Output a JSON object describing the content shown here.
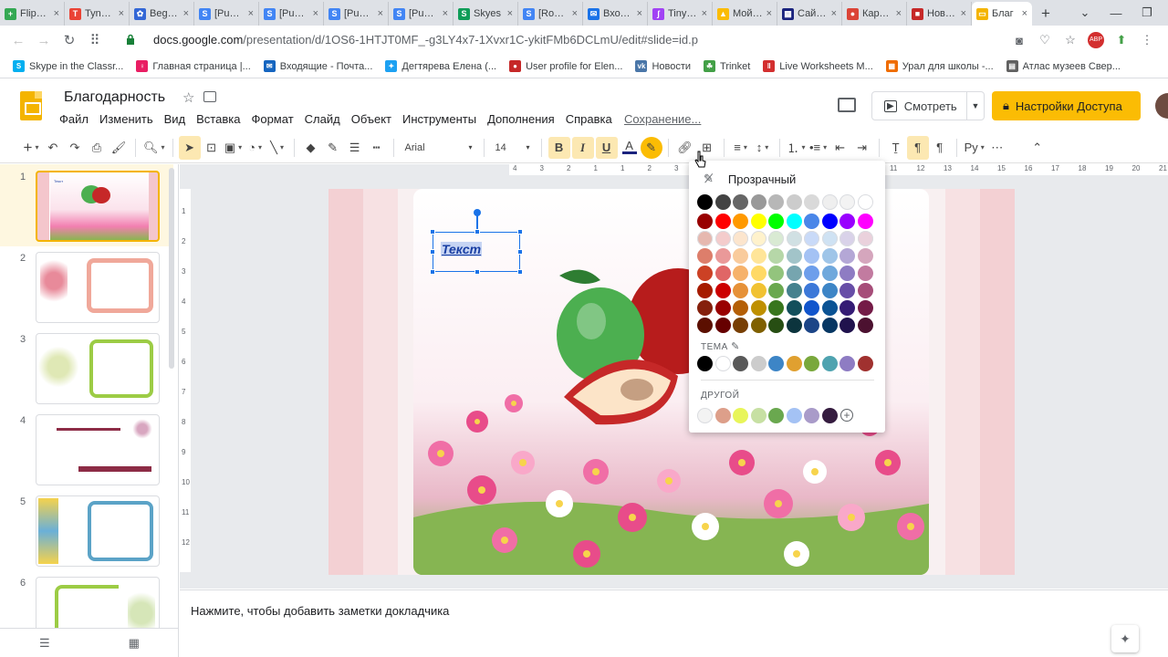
{
  "browser": {
    "tabs": [
      {
        "title": "Flipgrid",
        "color": "#34a853",
        "glyph": "+"
      },
      {
        "title": "Tynker",
        "color": "#ea4335",
        "glyph": "T"
      },
      {
        "title": "Beginne",
        "color": "#3367d6",
        "glyph": "✿"
      },
      {
        "title": "[Public]",
        "color": "#4285f4",
        "glyph": "S"
      },
      {
        "title": "[Public]",
        "color": "#4285f4",
        "glyph": "S"
      },
      {
        "title": "[Public]",
        "color": "#4285f4",
        "glyph": "S"
      },
      {
        "title": "[Public]",
        "color": "#4285f4",
        "glyph": "S"
      },
      {
        "title": "Skyes",
        "color": "#0f9d58",
        "glyph": "S"
      },
      {
        "title": "[Room]",
        "color": "#4285f4",
        "glyph": "S"
      },
      {
        "title": "Входящ",
        "color": "#1a73e8",
        "glyph": "✉"
      },
      {
        "title": "TinyTap",
        "color": "#a142f4",
        "glyph": "ʃ"
      },
      {
        "title": "Мой дис",
        "color": "#fbbc04",
        "glyph": "▲"
      },
      {
        "title": "Сайт бе",
        "color": "#1a237e",
        "glyph": "▦"
      },
      {
        "title": "Карта б",
        "color": "#db4437",
        "glyph": "●"
      },
      {
        "title": "Новый",
        "color": "#c62828",
        "glyph": "■"
      }
    ],
    "active_tab": {
      "title": "Благ",
      "color": "#f4b400"
    },
    "url_host": "docs.google.com",
    "url_path": "/presentation/d/1OS6-1HTJT0MF_-g3LY4x7-1Xvxr1C-ykitFMb6DCLmU/edit#slide=id.p",
    "bookmarks": [
      {
        "label": "Skype in the Classr...",
        "color": "#00aff0",
        "glyph": "S"
      },
      {
        "label": "Главная страница |...",
        "color": "#e91e63",
        "glyph": "♀"
      },
      {
        "label": "Входящие - Почта...",
        "color": "#1565c0",
        "glyph": "✉"
      },
      {
        "label": "Дегтярева Елена (...",
        "color": "#1da1f2",
        "glyph": "✦"
      },
      {
        "label": "User profile for Elen...",
        "color": "#c62828",
        "glyph": "●"
      },
      {
        "label": "Новости",
        "color": "#4a76a8",
        "glyph": "vk"
      },
      {
        "label": "Trinket",
        "color": "#43a047",
        "glyph": "☘"
      },
      {
        "label": "Live Worksheets M...",
        "color": "#d32f2f",
        "glyph": "‖"
      },
      {
        "label": "Урал для школы -...",
        "color": "#ef6c00",
        "glyph": "▦"
      },
      {
        "label": "Атлас музеев Свер...",
        "color": "#616161",
        "glyph": "▤"
      }
    ]
  },
  "doc": {
    "title": "Благодарность",
    "menu": [
      "Файл",
      "Изменить",
      "Вид",
      "Вставка",
      "Формат",
      "Слайд",
      "Объект",
      "Инструменты",
      "Дополнения",
      "Справка"
    ],
    "status": "Сохранение...",
    "present_label": "Смотреть",
    "share_label": "Настройки Доступа"
  },
  "toolbar": {
    "font": "Arial",
    "size": "14",
    "bold": "B",
    "italic": "I",
    "underline": "U",
    "text_color_glyph": "A"
  },
  "filmstrip": {
    "slides": [
      {
        "num": "1"
      },
      {
        "num": "2"
      },
      {
        "num": "3"
      },
      {
        "num": "4"
      },
      {
        "num": "5"
      },
      {
        "num": "6"
      }
    ]
  },
  "ruler": {
    "top": [
      "4",
      "3",
      "2",
      "1",
      "1",
      "2",
      "3",
      "4",
      "5",
      "6",
      "7",
      "8",
      "9",
      "10",
      "11",
      "12",
      "13",
      "14",
      "15",
      "16",
      "17",
      "18",
      "19",
      "20",
      "21"
    ],
    "left": [
      "1",
      "2",
      "3",
      "4",
      "5",
      "6",
      "7",
      "8",
      "9",
      "10",
      "11",
      "12"
    ]
  },
  "slide": {
    "textbox_text": "Текст"
  },
  "notes": {
    "placeholder": "Нажмите, чтобы добавить заметки докладчика"
  },
  "color_popup": {
    "transparent_label": "Прозрачный",
    "theme_label": "ТЕМА",
    "custom_label": "ДРУГОЙ",
    "grid": [
      [
        "#000000",
        "#434343",
        "#666666",
        "#999999",
        "#b7b7b7",
        "#cccccc",
        "#d9d9d9",
        "#efefef",
        "#f3f3f3",
        "#ffffff"
      ],
      [
        "#980000",
        "#ff0000",
        "#ff9900",
        "#ffff00",
        "#00ff00",
        "#00ffff",
        "#4a86e8",
        "#0000ff",
        "#9900ff",
        "#ff00ff"
      ],
      [
        "#e6b8af",
        "#f4cccc",
        "#fce5cd",
        "#fff2cc",
        "#d9ead3",
        "#d0e0e3",
        "#c9daf8",
        "#cfe2f3",
        "#d9d2e9",
        "#ead1dc"
      ],
      [
        "#dd7e6b",
        "#ea9999",
        "#f9cb9c",
        "#ffe599",
        "#b6d7a8",
        "#a2c4c9",
        "#a4c2f4",
        "#9fc5e8",
        "#b4a7d6",
        "#d5a6bd"
      ],
      [
        "#cc4125",
        "#e06666",
        "#f6b26b",
        "#ffd966",
        "#93c47d",
        "#76a5af",
        "#6d9eeb",
        "#6fa8dc",
        "#8e7cc3",
        "#c27ba0"
      ],
      [
        "#a61c00",
        "#cc0000",
        "#e69138",
        "#f1c232",
        "#6aa84f",
        "#45818e",
        "#3c78d8",
        "#3d85c6",
        "#674ea7",
        "#a64d79"
      ],
      [
        "#85200c",
        "#990000",
        "#b45f06",
        "#bf9000",
        "#38761d",
        "#134f5c",
        "#1155cc",
        "#0b5394",
        "#351c75",
        "#741b47"
      ],
      [
        "#5b0f00",
        "#660000",
        "#783f04",
        "#7f6000",
        "#274e13",
        "#0c343d",
        "#1c4587",
        "#073763",
        "#20124d",
        "#4c1130"
      ]
    ],
    "theme": [
      "#000000",
      "#ffffff",
      "#595959",
      "#cccccc",
      "#3d85c6",
      "#e0a030",
      "#79a83c",
      "#4fa3b0",
      "#8e7cc3",
      "#a0312f"
    ],
    "custom": [
      "#f3f3f3",
      "#dd9f8a",
      "#e8f55a",
      "#c7e0a3",
      "#6aa84f",
      "#a4c2f4",
      "#a99bc9",
      "#351c3f"
    ]
  }
}
